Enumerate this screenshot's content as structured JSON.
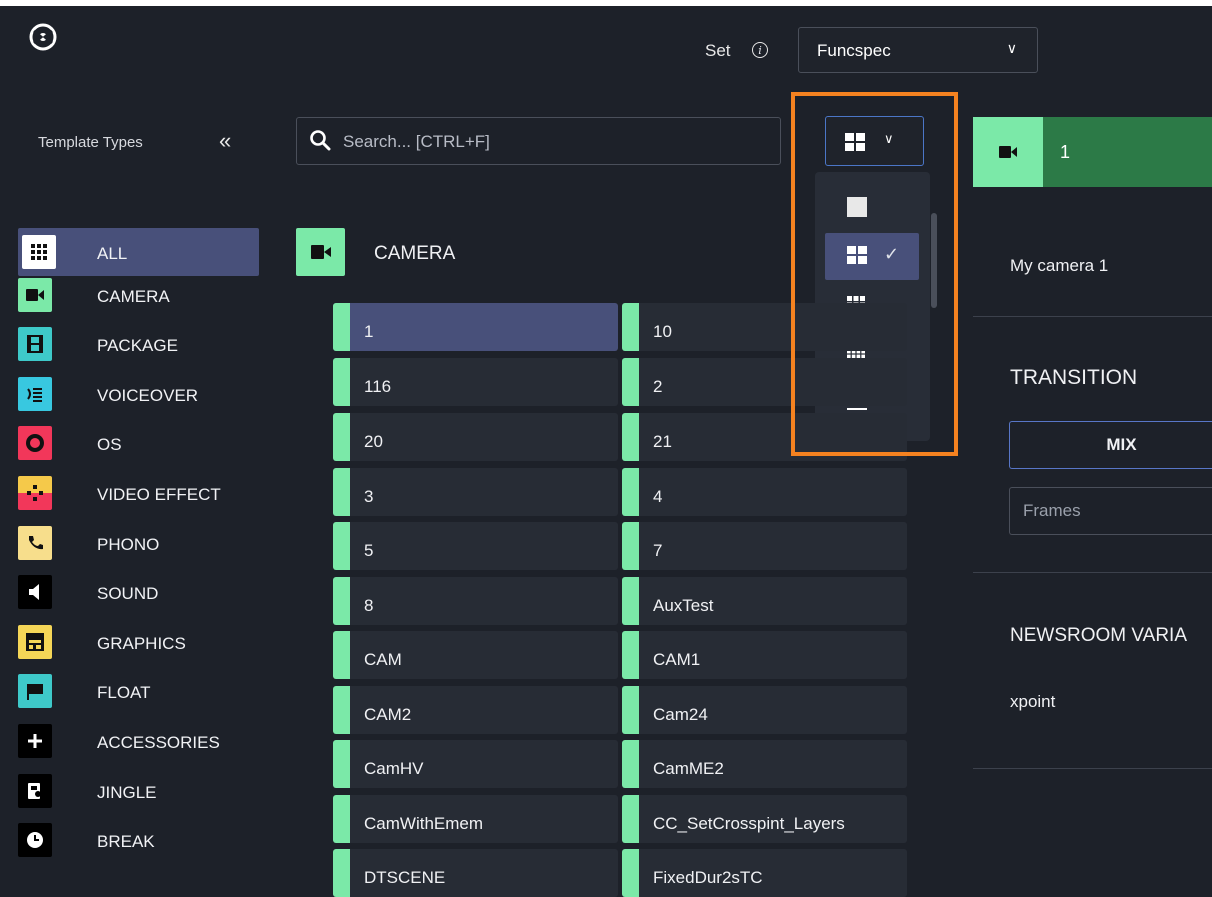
{
  "header": {
    "set_label": "Set",
    "info_icon": "info-icon",
    "set_value": "Funcspec"
  },
  "sidebar": {
    "title": "Template Types",
    "categories": [
      {
        "label": "ALL",
        "icon": "grid-icon",
        "color": "#ffffff",
        "active": true
      },
      {
        "label": "CAMERA",
        "icon": "camera-icon",
        "color": "#7be9a8"
      },
      {
        "label": "PACKAGE",
        "icon": "film-icon",
        "color": "#3ec9c9"
      },
      {
        "label": "VOICEOVER",
        "icon": "voiceover-icon",
        "color": "#38c8e0"
      },
      {
        "label": "OS",
        "icon": "record-icon",
        "color": "#f2375a"
      },
      {
        "label": "VIDEO EFFECT",
        "icon": "effect-icon",
        "color": "#f5c94a"
      },
      {
        "label": "PHONO",
        "icon": "phone-icon",
        "color": "#f7de8c"
      },
      {
        "label": "SOUND",
        "icon": "speaker-icon",
        "color": "#000000"
      },
      {
        "label": "GRAPHICS",
        "icon": "graphics-icon",
        "color": "#f5d657"
      },
      {
        "label": "FLOAT",
        "icon": "flag-icon",
        "color": "#3ec9c9"
      },
      {
        "label": "ACCESSORIES",
        "icon": "plus-icon",
        "color": "#000000"
      },
      {
        "label": "JINGLE",
        "icon": "jingle-icon",
        "color": "#000000"
      },
      {
        "label": "BREAK",
        "icon": "clock-icon",
        "color": "#000000"
      }
    ]
  },
  "search": {
    "placeholder": "Search... [CTRL+F]"
  },
  "view_menu": {
    "options": [
      {
        "name": "single-view",
        "selected": false
      },
      {
        "name": "grid-2x2-view",
        "selected": true
      },
      {
        "name": "grid-3x3-view",
        "selected": false
      },
      {
        "name": "grid-4x4-view",
        "selected": false
      },
      {
        "name": "list-view",
        "selected": false
      }
    ]
  },
  "section": {
    "title": "CAMERA"
  },
  "templates": [
    {
      "name": "1",
      "selected": true
    },
    {
      "name": "10"
    },
    {
      "name": "116"
    },
    {
      "name": "2"
    },
    {
      "name": "20"
    },
    {
      "name": "21"
    },
    {
      "name": "3"
    },
    {
      "name": "4"
    },
    {
      "name": "5"
    },
    {
      "name": "7"
    },
    {
      "name": "8"
    },
    {
      "name": "AuxTest"
    },
    {
      "name": "CAM"
    },
    {
      "name": "CAM1"
    },
    {
      "name": "CAM2"
    },
    {
      "name": "Cam24"
    },
    {
      "name": "CamHV"
    },
    {
      "name": "CamME2"
    },
    {
      "name": "CamWithEmem"
    },
    {
      "name": "CC_SetCrosspint_Layers"
    },
    {
      "name": "DTSCENE"
    },
    {
      "name": "FixedDur2sTC"
    }
  ],
  "right_panel": {
    "template_number": "1",
    "name_value": "My camera 1",
    "transition_heading": "TRANSITION",
    "transition_button": "MIX",
    "frames_placeholder": "Frames",
    "newsroom_heading": "NEWSROOM VARIA",
    "newsroom_value": "xpoint"
  },
  "colors": {
    "accent": "#48507a",
    "camera_green": "#7be9a8",
    "highlight": "#f58220",
    "focus_blue": "#4b76c7"
  }
}
